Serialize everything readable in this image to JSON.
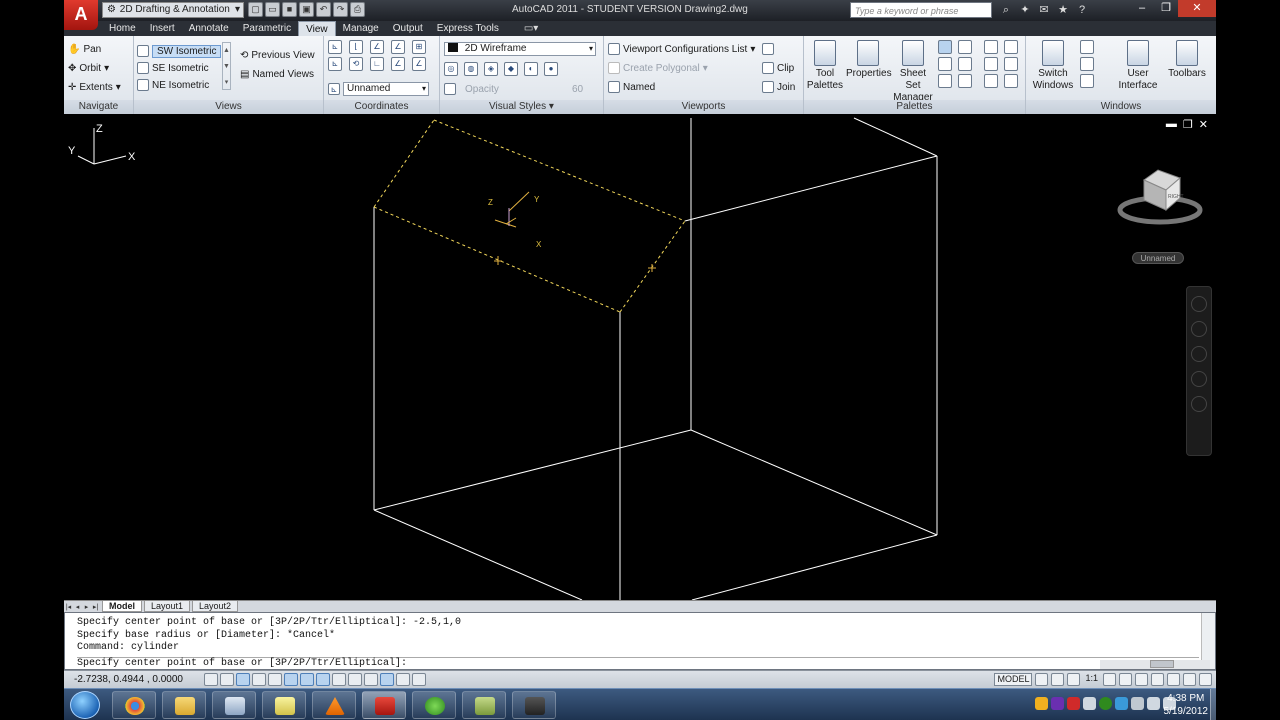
{
  "app": {
    "logo_letter": "A",
    "workspace": "2D Drafting & Annotation",
    "title": "AutoCAD 2011 - STUDENT VERSION    Drawing2.dwg",
    "search_placeholder": "Type a keyword or phrase"
  },
  "tabs": [
    "Home",
    "Insert",
    "Annotate",
    "Parametric",
    "View",
    "Manage",
    "Output",
    "Express Tools"
  ],
  "active_tab": "View",
  "ribbon": {
    "navigate": {
      "title": "Navigate",
      "pan": "Pan",
      "orbit": "Orbit",
      "extents": "Extents"
    },
    "views": {
      "title": "Views",
      "presets": [
        "SW Isometric",
        "SE Isometric",
        "NE Isometric"
      ],
      "selected": "SW Isometric",
      "previous": "Previous View",
      "named": "Named Views"
    },
    "coordinates": {
      "title": "Coordinates",
      "ucs_name": "Unnamed"
    },
    "visual_styles": {
      "title": "Visual Styles",
      "current": "2D Wireframe",
      "opacity_label": "Opacity",
      "opacity_value": "60"
    },
    "viewports": {
      "title": "Viewports",
      "config_list": "Viewport Configurations List",
      "create_polygonal": "Create Polygonal",
      "named": "Named",
      "clip": "Clip",
      "join": "Join"
    },
    "palettes": {
      "title": "Palettes",
      "tool_palettes": "Tool Palettes",
      "properties": "Properties",
      "sheet_set": "Sheet Set Manager"
    },
    "windows": {
      "title": "Windows",
      "switch_windows": "Switch Windows",
      "user_interface": "User Interface",
      "toolbars": "Toolbars"
    }
  },
  "viewport": {
    "ucs_label": "Unnamed",
    "axis_x": "X",
    "axis_y": "Y",
    "axis_z": "Z",
    "viewcube_face": "RIGHT"
  },
  "layout_tabs": [
    "Model",
    "Layout1",
    "Layout2"
  ],
  "active_layout": "Model",
  "command": {
    "history": [
      "Specify center point of base or [3P/2P/Ttr/Elliptical]: -2.5,1,0",
      "Specify base radius or [Diameter]: *Cancel*",
      "Command: cylinder"
    ],
    "prompt": "Specify center point of base or [3P/2P/Ttr/Elliptical]:"
  },
  "status": {
    "coords": "-2.7238, 0.4944 , 0.0000",
    "model": "MODEL",
    "scale": "1:1"
  },
  "taskbar": {
    "time": "4:38 PM",
    "date": "5/19/2012"
  }
}
